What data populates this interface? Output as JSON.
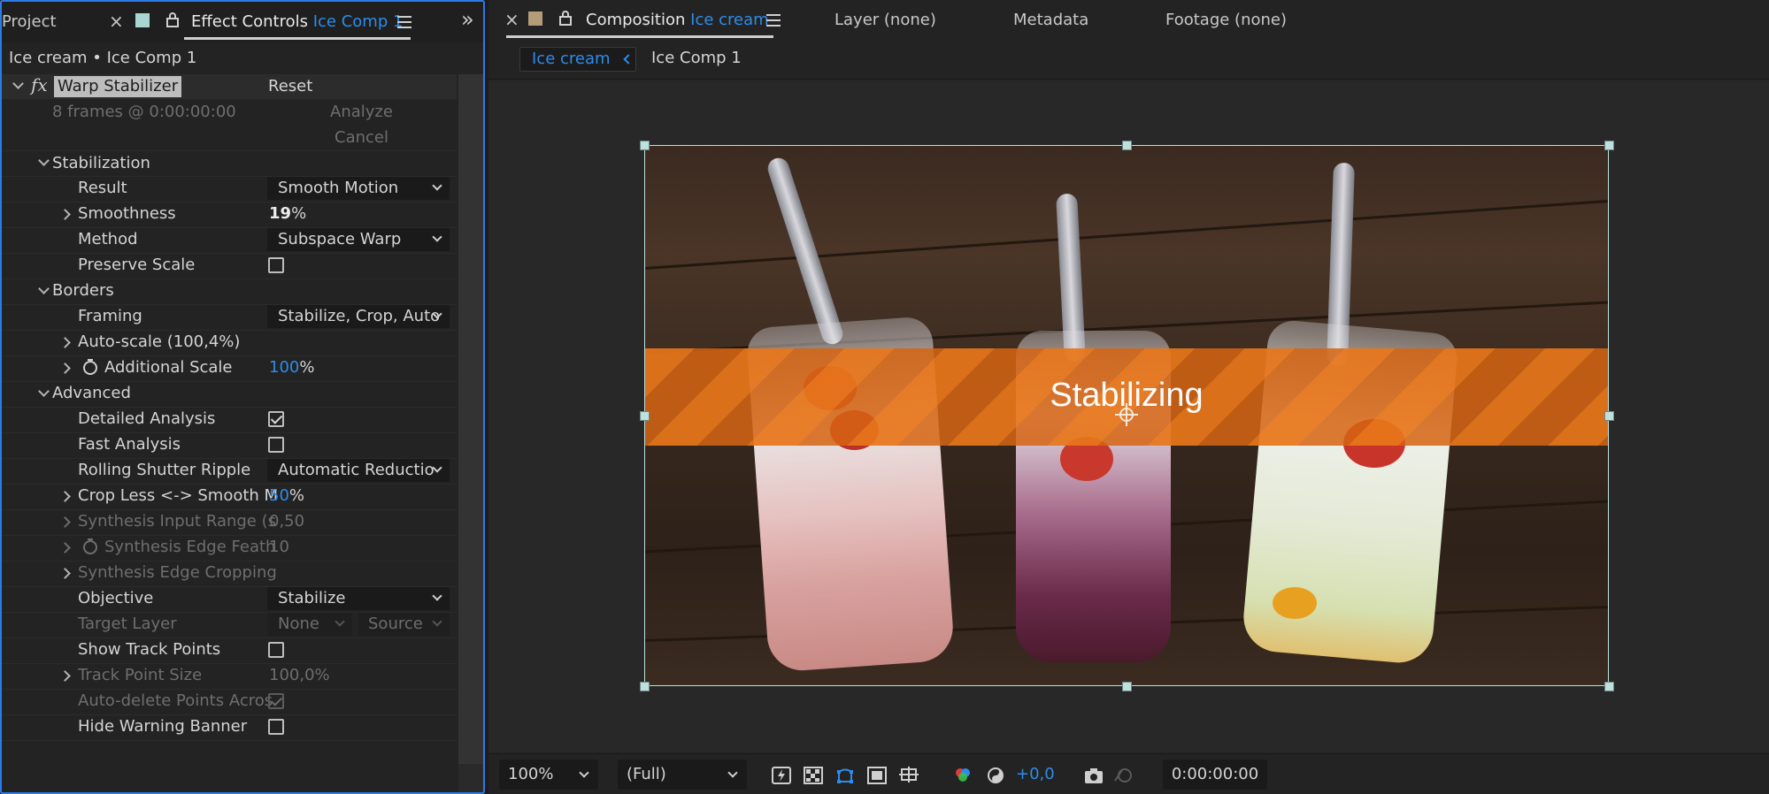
{
  "left_panel": {
    "tabs": {
      "project": "Project",
      "close": "×",
      "effect_controls": "Effect Controls",
      "effect_controls_target": "Ice Comp 1",
      "expand": "»"
    },
    "layer_path": "Ice cream • Ice Comp 1",
    "effect": {
      "fx": "fx",
      "name": "Warp Stabilizer",
      "reset": "Reset",
      "frames_info": "8 frames @ 0:00:00:00",
      "analyze": "Analyze",
      "cancel": "Cancel"
    },
    "rows": {
      "stabilization": "Stabilization",
      "result": "Result",
      "result_value": "Smooth Motion",
      "smoothness": "Smoothness",
      "smoothness_value": "19",
      "smoothness_unit": "%",
      "method": "Method",
      "method_value": "Subspace Warp",
      "preserve_scale": "Preserve Scale",
      "borders": "Borders",
      "framing": "Framing",
      "framing_value": "Stabilize, Crop, Auto",
      "auto_scale": "Auto-scale (100,4%)",
      "additional_scale": "Additional Scale",
      "additional_scale_value": "100",
      "additional_scale_unit": "%",
      "advanced": "Advanced",
      "detailed_analysis": "Detailed Analysis",
      "fast_analysis": "Fast Analysis",
      "rolling_shutter": "Rolling Shutter Ripple",
      "rolling_shutter_value": "Automatic Reductio",
      "crop_less": "Crop Less <-> Smooth M",
      "crop_less_value": "50",
      "crop_less_unit": "%",
      "synth_input_range": "Synthesis Input Range (s",
      "synth_input_range_value": "0,50",
      "synth_edge_feather": "Synthesis Edge Feath",
      "synth_edge_feather_value": "10",
      "synth_edge_cropping": "Synthesis Edge Cropping",
      "objective": "Objective",
      "objective_value": "Stabilize",
      "target_layer": "Target Layer",
      "target_layer_value": "None",
      "target_layer_source": "Source",
      "show_track_points": "Show Track Points",
      "track_point_size": "Track Point Size",
      "track_point_size_value": "100,0%",
      "auto_delete": "Auto-delete Points Acros",
      "hide_warning": "Hide Warning Banner"
    },
    "checkboxes": {
      "preserve_scale": false,
      "detailed_analysis": true,
      "fast_analysis": false,
      "show_track_points": false,
      "auto_delete": true,
      "hide_warning": false
    }
  },
  "right_panel": {
    "tabs": {
      "close": "×",
      "composition": "Composition",
      "composition_target": "Ice cream",
      "layer": "Layer (none)",
      "metadata": "Metadata",
      "footage": "Footage (none)"
    },
    "breadcrumbs": {
      "current": "Ice cream",
      "next": "Ice Comp 1"
    },
    "viewer": {
      "banner_text": "Stabilizing"
    },
    "bottom_bar": {
      "zoom": "100%",
      "resolution": "(Full)",
      "exposure": "+0,0",
      "timecode": "0:00:00:00"
    }
  },
  "colors": {
    "accent": "#2d8ceb",
    "banner": "#e8761a",
    "panel_bg": "#232323"
  }
}
